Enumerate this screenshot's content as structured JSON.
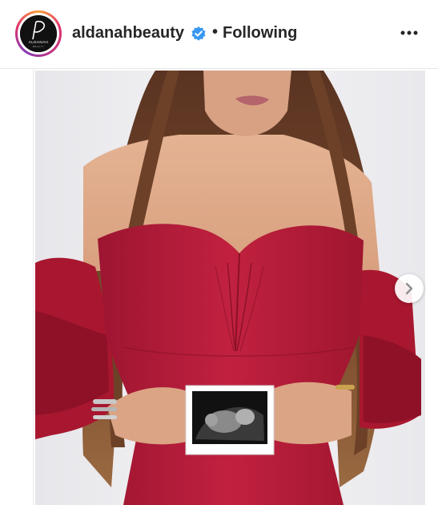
{
  "post_header": {
    "username": "aldanahbeauty",
    "separator": "•",
    "follow_status": "Following",
    "more_icon": "more-options-icon",
    "verified_icon": "verified-badge-icon"
  },
  "avatar": {
    "brand_name": "ALDANAH",
    "brand_sub": "BEAUTY"
  },
  "carousel": {
    "next_icon": "chevron-right-icon"
  },
  "colors": {
    "verified_blue": "#3897f0",
    "dress_red": "#b31b3a",
    "text_dark": "#262626"
  }
}
